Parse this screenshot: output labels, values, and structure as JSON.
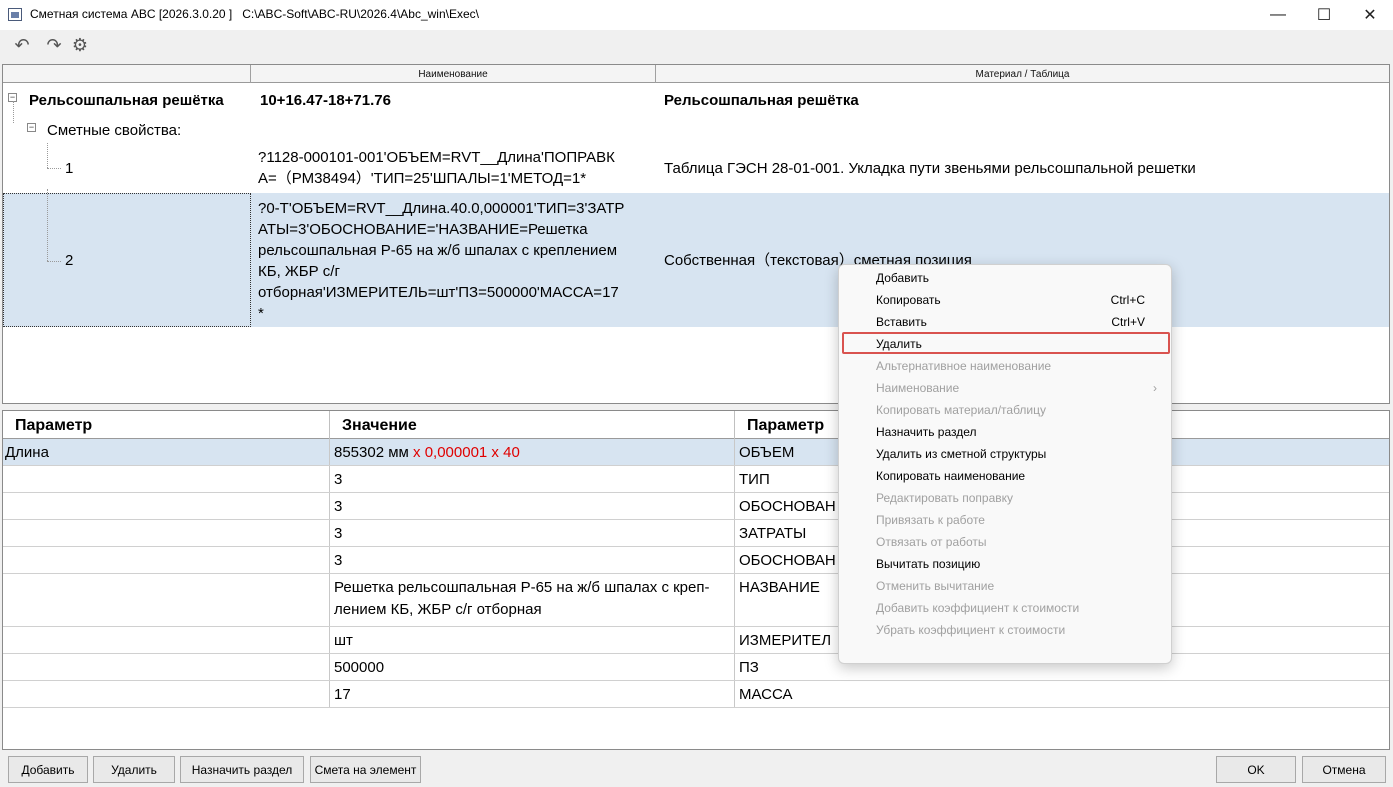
{
  "window": {
    "title": "Сметная система ABC [2026.3.0.20 ]   C:\\ABC-Soft\\ABC-RU\\2026.4\\Abc_win\\Exec\\",
    "minimize": "—",
    "maximize": "☐",
    "close": "✕"
  },
  "toolbar": {
    "undo_icon": "↶",
    "redo_icon": "↷",
    "settings_icon": "⚙"
  },
  "tree": {
    "columns": [
      "",
      "Наименование",
      "Материал / Таблица"
    ],
    "root": {
      "toggle": "−",
      "label": "Рельсошпальная решётка",
      "name": "10+16.47-18+71.76",
      "material": "Рельсошпальная решётка"
    },
    "props_node": {
      "toggle": "−",
      "label": "Сметные свойства:"
    },
    "items": [
      {
        "label": "1",
        "name_line1": "?1128-000101-001'ОБЪЕМ=RVT__Длина'ПОПРАВК",
        "name_line2": "А=（РМ38494）'ТИП=25'ШПАЛЫ=1'МЕТОД=1*",
        "material": "Таблица ГЭСН 28-01-001. Укладка пути звеньями рельсошпальной решетки"
      },
      {
        "label": "2",
        "name_line1": "?0-Т'ОБЪЕМ=RVT__Длина.40.0,000001'ТИП=3'ЗАТР",
        "name_line2": "АТЫ=3'ОБОСНОВАНИЕ='НАЗВАНИЕ=Решетка",
        "name_line3": "рельсошпальная Р-65 на ж/б шпалах с креплением",
        "name_line4": "КБ, ЖБР с/г",
        "name_line5": "отборная'ИЗМЕРИТЕЛЬ=шт'ПЗ=500000'МАССА=17",
        "name_line6": "*",
        "material": "Собственная（текстовая）сметная позиция"
      }
    ]
  },
  "params": {
    "headers": [
      "Параметр",
      "Значение",
      "Параметр"
    ],
    "rows": [
      {
        "param": "Длина",
        "value": "855302 мм",
        "value_extra": "x  0,000001 x 40",
        "param2": "ОБЪЕМ"
      },
      {
        "param": "",
        "value": "3",
        "param2": "ТИП"
      },
      {
        "param": "",
        "value": "3",
        "param2": "ОБОСНОВАН"
      },
      {
        "param": "",
        "value": "3",
        "param2": "ЗАТРАТЫ"
      },
      {
        "param": "",
        "value": "3",
        "param2": "ОБОСНОВАН"
      },
      {
        "param": "",
        "value": "Решетка рельсошпальная Р-65 на ж/б шпалах с креп-",
        "value_line2": "лением КБ, ЖБР с/г отборная",
        "param2": "НАЗВАНИЕ"
      },
      {
        "param": "",
        "value": "шт",
        "param2": "ИЗМЕРИТЕЛ"
      },
      {
        "param": "",
        "value": "500000",
        "param2": "ПЗ"
      },
      {
        "param": "",
        "value": "17",
        "param2": "МАССА"
      }
    ]
  },
  "buttons": {
    "add": "Добавить",
    "delete": "Удалить",
    "assign_section": "Назначить раздел",
    "estimate_for_element": "Смета на элемент",
    "ok": "OK",
    "cancel": "Отмена"
  },
  "context_menu": {
    "items": [
      {
        "label": "Добавить",
        "enabled": true
      },
      {
        "label": "Копировать",
        "shortcut": "Ctrl+C",
        "enabled": true
      },
      {
        "label": "Вставить",
        "shortcut": "Ctrl+V",
        "enabled": true
      },
      {
        "label": "Удалить",
        "enabled": true,
        "highlighted": true
      },
      {
        "label": "Альтернативное наименование",
        "enabled": false
      },
      {
        "label": "Наименование",
        "enabled": false,
        "submenu": "›"
      },
      {
        "label": "Копировать материал/таблицу",
        "enabled": false
      },
      {
        "label": "Назначить раздел",
        "enabled": true
      },
      {
        "label": "Удалить из сметной структуры",
        "enabled": true
      },
      {
        "label": "Копировать наименование",
        "enabled": true
      },
      {
        "label": "Редактировать поправку",
        "enabled": false
      },
      {
        "label": "Привязать к работе",
        "enabled": false
      },
      {
        "label": "Отвязать от работы",
        "enabled": false
      },
      {
        "label": "Вычитать позицию",
        "enabled": true
      },
      {
        "label": "Отменить вычитание",
        "enabled": false
      },
      {
        "label": "Добавить коэффициент к стоимости",
        "enabled": false
      },
      {
        "label": "Убрать коэффициент к стоимости",
        "enabled": false
      }
    ],
    "highlight_color": "#d9534f"
  },
  "colors": {
    "selection": "#d7e4f1",
    "red_value": "#e00000"
  }
}
